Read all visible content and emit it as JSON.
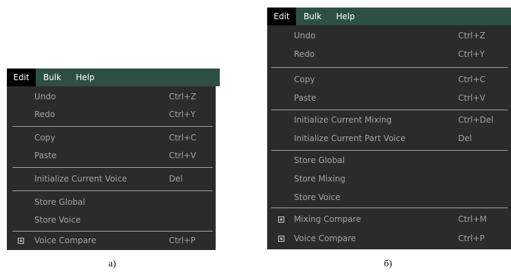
{
  "panel_a": {
    "menubar": {
      "edit": "Edit",
      "bulk": "Bulk",
      "help": "Help"
    },
    "items": {
      "undo": {
        "label": "Undo",
        "shortcut": "Ctrl+Z"
      },
      "redo": {
        "label": "Redo",
        "shortcut": "Ctrl+Y"
      },
      "copy": {
        "label": "Copy",
        "shortcut": "Ctrl+C"
      },
      "paste": {
        "label": "Paste",
        "shortcut": "Ctrl+V"
      },
      "init_voice": {
        "label": "Initialize Current Voice",
        "shortcut": "Del"
      },
      "store_global": {
        "label": "Store Global"
      },
      "store_voice": {
        "label": "Store Voice"
      },
      "voice_compare": {
        "label": "Voice Compare",
        "shortcut": "Ctrl+P"
      }
    },
    "caption": "a)"
  },
  "panel_b": {
    "menubar": {
      "edit": "Edit",
      "bulk": "Bulk",
      "help": "Help"
    },
    "items": {
      "undo": {
        "label": "Undo",
        "shortcut": "Ctrl+Z"
      },
      "redo": {
        "label": "Redo",
        "shortcut": "Ctrl+Y"
      },
      "copy": {
        "label": "Copy",
        "shortcut": "Ctrl+C"
      },
      "paste": {
        "label": "Paste",
        "shortcut": "Ctrl+V"
      },
      "init_mixing": {
        "label": "Initialize Current Mixing",
        "shortcut": "Ctrl+Del"
      },
      "init_part_voice": {
        "label": "Initialize Current Part Voice",
        "shortcut": "Del"
      },
      "store_global": {
        "label": "Store Global"
      },
      "store_mixing": {
        "label": "Store Mixing"
      },
      "store_voice": {
        "label": "Store Voice"
      },
      "mixing_compare": {
        "label": "Mixing Compare",
        "shortcut": "Ctrl+M"
      },
      "voice_compare": {
        "label": "Voice Compare",
        "shortcut": "Ctrl+P"
      }
    },
    "caption": "б)"
  },
  "colors": {
    "menubar_bg": "#2e4f45",
    "active_title_bg": "#000000",
    "dropdown_bg": "#2b2b2b",
    "item_text": "#a5a5a5",
    "separator": "#a8a8a8"
  },
  "icons": {
    "compare_toggle": "checkbox-square-icon"
  }
}
